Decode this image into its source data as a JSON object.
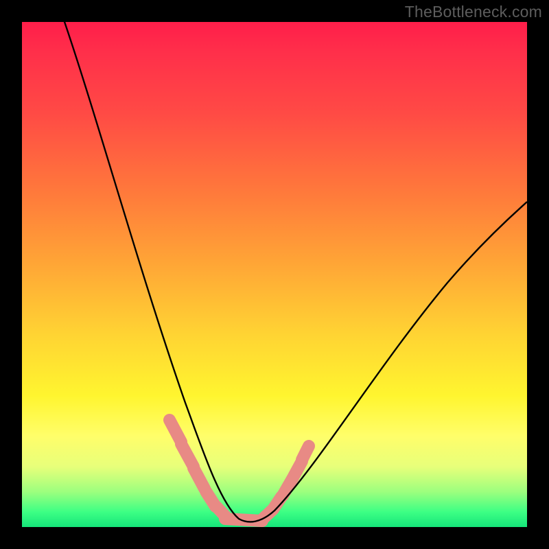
{
  "watermark": "TheBottleneck.com",
  "chart_data": {
    "type": "line",
    "title": "",
    "xlabel": "",
    "ylabel": "",
    "xlim": [
      0,
      100
    ],
    "ylim": [
      0,
      100
    ],
    "grid": false,
    "legend": false,
    "series": [
      {
        "name": "black-curve",
        "color": "#000000",
        "x": [
          10,
          14,
          18,
          22,
          26,
          30,
          34,
          36,
          38,
          40,
          42,
          44,
          46,
          48,
          50,
          54,
          58,
          62,
          66,
          70,
          74,
          78,
          82,
          86,
          90,
          94,
          98,
          100
        ],
        "y": [
          100,
          89,
          78,
          67,
          57,
          47,
          38,
          33,
          29,
          25,
          21,
          18,
          14,
          11,
          8,
          4,
          2,
          1,
          2,
          6,
          11,
          18,
          25,
          33,
          41,
          49,
          57,
          61
        ]
      },
      {
        "name": "pink-confidence-band",
        "color": "#e98c87",
        "type": "area",
        "x": [
          34,
          36,
          38,
          40,
          42,
          44,
          46,
          48,
          50
        ],
        "y_low": [
          14,
          10,
          7,
          4,
          2,
          1,
          1,
          2,
          4
        ],
        "y_high": [
          22,
          18,
          14,
          10,
          7,
          5,
          4,
          5,
          8
        ],
        "note": "approximate extent of the pale-red highlighted segment near the trough"
      }
    ]
  }
}
